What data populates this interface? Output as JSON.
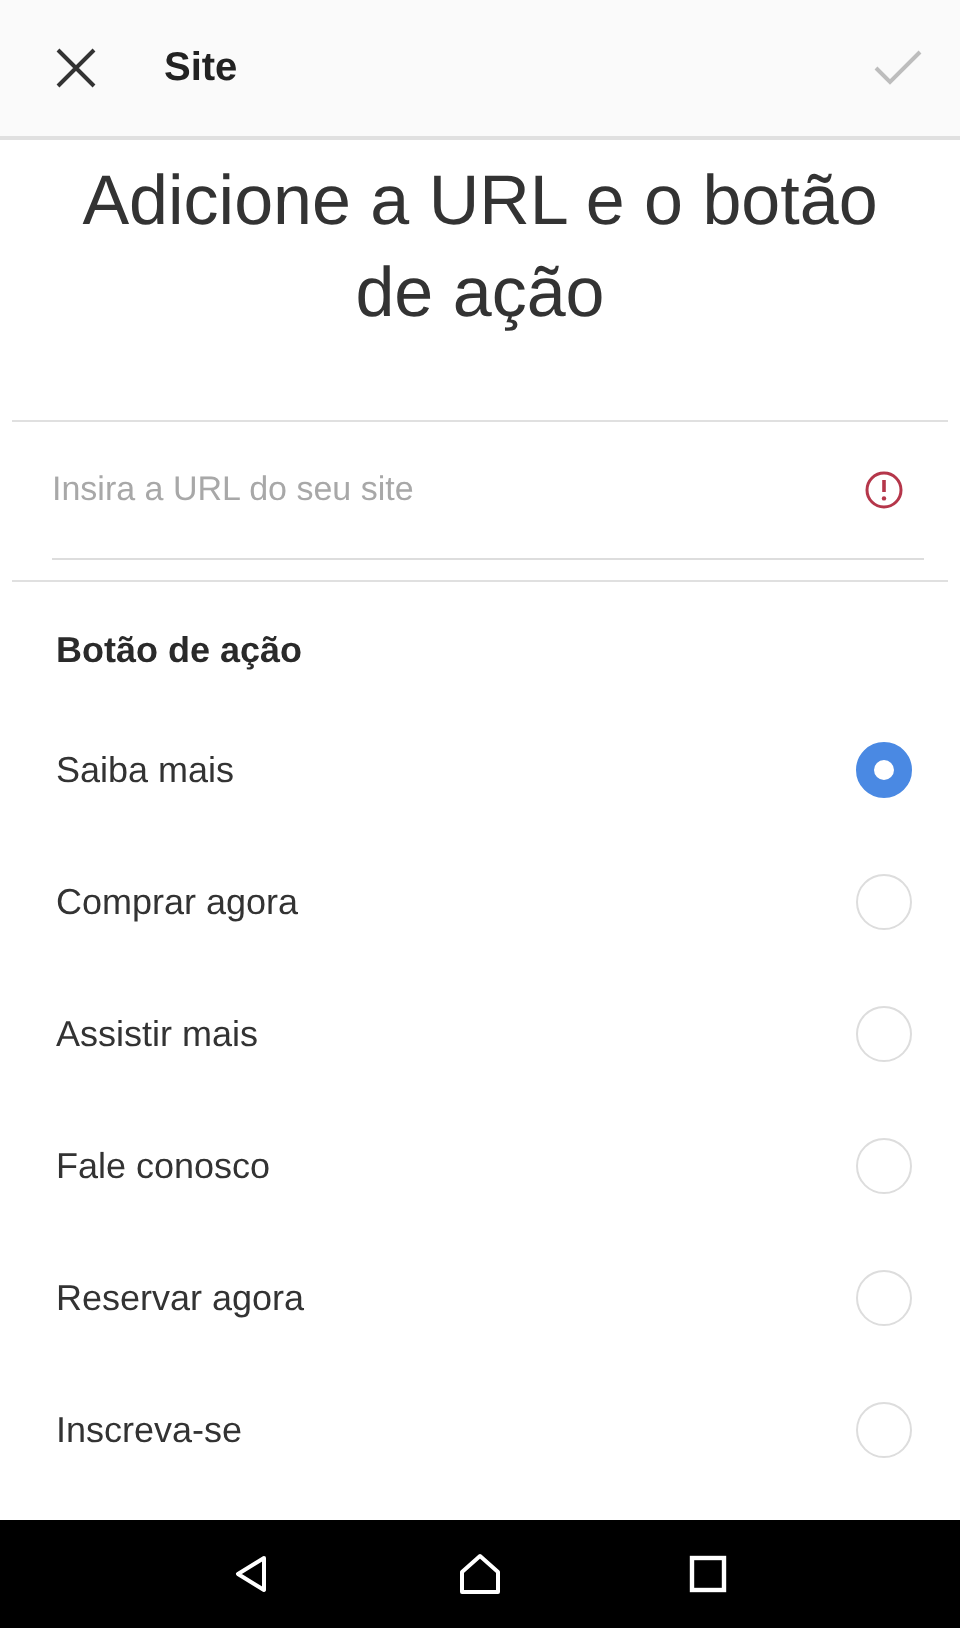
{
  "header": {
    "title": "Site"
  },
  "heading": "Adicione a URL e o botão de ação",
  "url_field": {
    "placeholder": "Insira a URL do seu site",
    "error": true
  },
  "section": {
    "title": "Botão de ação"
  },
  "options": [
    {
      "label": "Saiba mais",
      "selected": true
    },
    {
      "label": "Comprar agora",
      "selected": false
    },
    {
      "label": "Assistir mais",
      "selected": false
    },
    {
      "label": "Fale conosco",
      "selected": false
    },
    {
      "label": "Reservar agora",
      "selected": false
    },
    {
      "label": "Inscreva-se",
      "selected": false
    }
  ]
}
